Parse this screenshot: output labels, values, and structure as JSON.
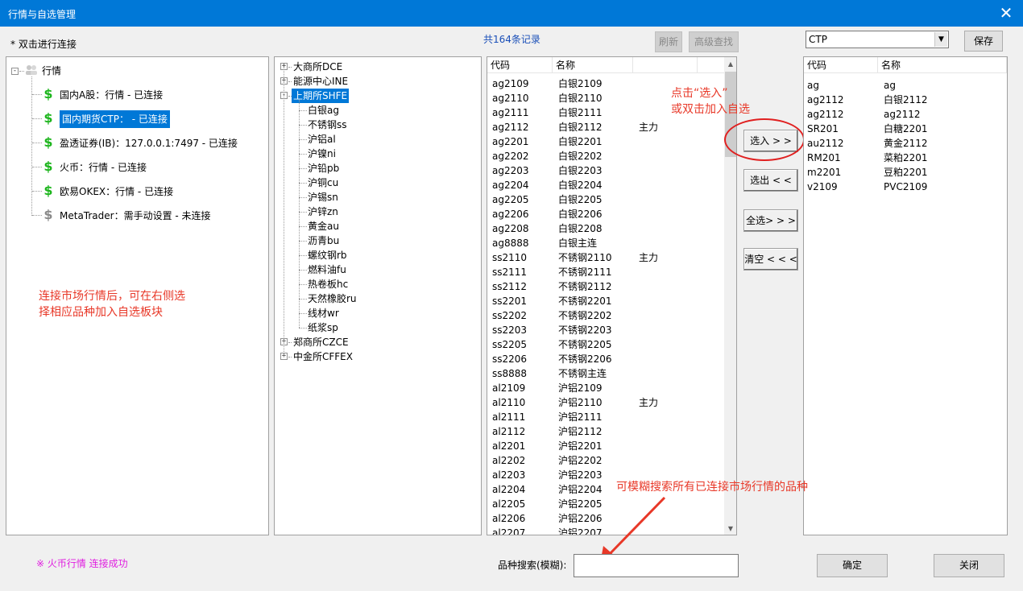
{
  "window": {
    "title": "行情与自选管理",
    "close_glyph": "✕"
  },
  "hint_double_click": "* 双击进行连接",
  "record_count": "共164条记录",
  "buttons": {
    "refresh": "刷新",
    "advanced_search": "高级查找",
    "save": "保存",
    "select_in": "选入 > >",
    "select_out": "选出 < <",
    "select_all": "全选> > >",
    "clear": "清空 < < <",
    "ok": "确定",
    "close": "关闭"
  },
  "preset_select": {
    "value": "CTP",
    "arrow": "▼"
  },
  "connections": {
    "root_label": "行情",
    "items": [
      {
        "label": "国内A股：行情 - 已连接",
        "icon": "dollar-icon",
        "connected": true
      },
      {
        "label": "国内期货CTP：  - 已连接",
        "icon": "dollar-icon",
        "connected": true,
        "selected": true
      },
      {
        "label": "盈透证券(IB)：127.0.0.1:7497 - 已连接",
        "icon": "dollar-icon",
        "connected": true
      },
      {
        "label": "火币：行情 - 已连接",
        "icon": "dollar-icon",
        "connected": true
      },
      {
        "label": "欧易OKEX：行情 - 已连接",
        "icon": "dollar-icon",
        "connected": true
      },
      {
        "label": "MetaTrader：需手动设置 - 未连接",
        "icon": "dollar-icon",
        "connected": false
      }
    ],
    "dollar_glyph": "$"
  },
  "left_annotation": {
    "line1": "连接市场行情后，可在右侧选",
    "line2": "择相应品种加入自选板块"
  },
  "exchange_tree": {
    "expand_plus": "+",
    "expand_minus": "-",
    "top": [
      {
        "label": "大商所DCE"
      },
      {
        "label": "能源中心INE"
      }
    ],
    "open": {
      "label": "上期所SHFE",
      "children": [
        "白银ag",
        "不锈钢ss",
        "沪铝al",
        "沪镍ni",
        "沪铅pb",
        "沪铜cu",
        "沪锡sn",
        "沪锌zn",
        "黄金au",
        "沥青bu",
        "螺纹钢rb",
        "燃料油fu",
        "热卷板hc",
        "天然橡胶ru",
        "线材wr",
        "纸浆sp"
      ]
    },
    "bottom": [
      {
        "label": "郑商所CZCE"
      },
      {
        "label": "中金所CFFEX"
      }
    ]
  },
  "contracts_table": {
    "headers": [
      "代码",
      "名称"
    ],
    "rows": [
      [
        "ag2109",
        "白银2109",
        ""
      ],
      [
        "ag2110",
        "白银2110",
        ""
      ],
      [
        "ag2111",
        "白银2111",
        ""
      ],
      [
        "ag2112",
        "白银2112",
        "主力"
      ],
      [
        "ag2201",
        "白银2201",
        ""
      ],
      [
        "ag2202",
        "白银2202",
        ""
      ],
      [
        "ag2203",
        "白银2203",
        ""
      ],
      [
        "ag2204",
        "白银2204",
        ""
      ],
      [
        "ag2205",
        "白银2205",
        ""
      ],
      [
        "ag2206",
        "白银2206",
        ""
      ],
      [
        "ag2208",
        "白银2208",
        ""
      ],
      [
        "ag8888",
        "白银主连",
        ""
      ],
      [
        "ss2110",
        "不锈钢2110",
        "主力"
      ],
      [
        "ss2111",
        "不锈钢2111",
        ""
      ],
      [
        "ss2112",
        "不锈钢2112",
        ""
      ],
      [
        "ss2201",
        "不锈钢2201",
        ""
      ],
      [
        "ss2202",
        "不锈钢2202",
        ""
      ],
      [
        "ss2203",
        "不锈钢2203",
        ""
      ],
      [
        "ss2205",
        "不锈钢2205",
        ""
      ],
      [
        "ss2206",
        "不锈钢2206",
        ""
      ],
      [
        "ss8888",
        "不锈钢主连",
        ""
      ],
      [
        "al2109",
        "沪铝2109",
        ""
      ],
      [
        "al2110",
        "沪铝2110",
        "主力"
      ],
      [
        "al2111",
        "沪铝2111",
        ""
      ],
      [
        "al2112",
        "沪铝2112",
        ""
      ],
      [
        "al2201",
        "沪铝2201",
        ""
      ],
      [
        "al2202",
        "沪铝2202",
        ""
      ],
      [
        "al2203",
        "沪铝2203",
        ""
      ],
      [
        "al2204",
        "沪铝2204",
        ""
      ],
      [
        "al2205",
        "沪铝2205",
        ""
      ],
      [
        "al2206",
        "沪铝2206",
        ""
      ],
      [
        "al2207",
        "沪铝2207",
        ""
      ]
    ],
    "scroll_up": "▲",
    "scroll_down": "▼"
  },
  "watchlist_table": {
    "headers": [
      "代码",
      "名称"
    ],
    "rows": [
      [
        "ag",
        "ag"
      ],
      [
        "ag2112",
        "白银2112"
      ],
      [
        "ag2112",
        "ag2112"
      ],
      [
        "SR201",
        "白糖2201"
      ],
      [
        "au2112",
        "黄金2112"
      ],
      [
        "RM201",
        "菜粕2201"
      ],
      [
        "m2201",
        "豆粕2201"
      ],
      [
        "v2109",
        "PVC2109"
      ]
    ]
  },
  "select_annotation": {
    "line1": "点击“选入”",
    "line2": "或双击加入自选"
  },
  "search_annotation": "可模糊搜索所有已连接市场行情的品种",
  "search": {
    "label": "品种搜索(模糊):",
    "value": ""
  },
  "status_message": "※ 火币行情 连接成功",
  "colors": {
    "title_bar": "#0078d7",
    "selection": "#0078d7",
    "annotation": "#e83828",
    "status": "#e020e0",
    "link_blue": "#1a4fb8",
    "dollar_green": "#1db51d"
  }
}
